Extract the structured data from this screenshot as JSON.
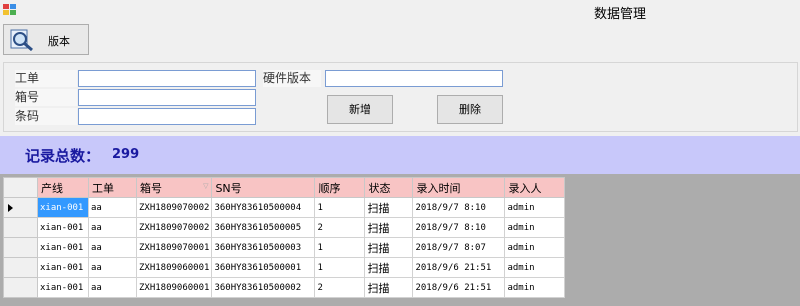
{
  "window": {
    "title": "数据管理"
  },
  "toolbar": {
    "version_label": "版本"
  },
  "form": {
    "work_order_label": "工单",
    "work_order_value": "",
    "box_no_label": "箱号",
    "box_no_value": "",
    "barcode_label": "条码",
    "barcode_value": "",
    "hw_version_label": "硬件版本",
    "hw_version_value": "",
    "add_label": "新增",
    "delete_label": "删除"
  },
  "summary": {
    "label": "记录总数：",
    "count": "299"
  },
  "table": {
    "columns": [
      "产线",
      "工单",
      "箱号",
      "SN号",
      "顺序",
      "状态",
      "录入时间",
      "录入人"
    ],
    "rows": [
      [
        "xian-001",
        "aa",
        "ZXH1809070002",
        "360HY83610500004",
        "1",
        "扫描",
        "2018/9/7 8:10",
        "admin"
      ],
      [
        "xian-001",
        "aa",
        "ZXH1809070002",
        "360HY83610500005",
        "2",
        "扫描",
        "2018/9/7 8:10",
        "admin"
      ],
      [
        "xian-001",
        "aa",
        "ZXH1809070001",
        "360HY83610500003",
        "1",
        "扫描",
        "2018/9/7 8:07",
        "admin"
      ],
      [
        "xian-001",
        "aa",
        "ZXH1809060001",
        "360HY83610500001",
        "1",
        "扫描",
        "2018/9/6 21:51",
        "admin"
      ],
      [
        "xian-001",
        "aa",
        "ZXH1809060001",
        "360HY83610500002",
        "2",
        "扫描",
        "2018/9/6 21:51",
        "admin"
      ]
    ]
  },
  "colors": {
    "header_bg": "#f8c4c4",
    "summary_bg": "#c8c8fa",
    "summary_text": "#1a1aa0",
    "selection": "#3399ff",
    "grid_backdrop": "#acacac"
  },
  "icons": {
    "app": "app-icon",
    "version_button": "magnifier-icon",
    "current_row": "row-pointer-icon"
  }
}
